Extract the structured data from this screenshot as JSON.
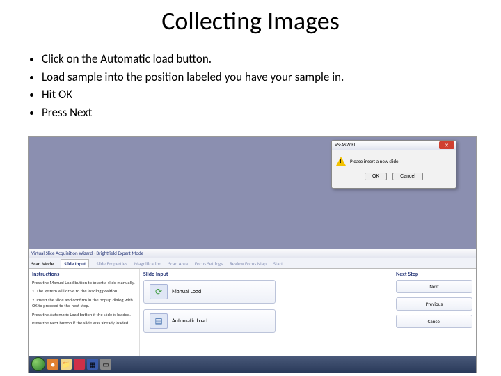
{
  "title": "Collecting Images",
  "bullets": [
    "Click on the Automatic load button.",
    "Load sample into the position labeled you have your sample in.",
    "Hit OK",
    "Press Next"
  ],
  "dialog": {
    "title": "VS-ASW FL",
    "message": "Please insert a new slide.",
    "ok": "OK",
    "cancel": "Cancel"
  },
  "wizard": {
    "window_title": "Virtual Slice Acquisition Wizard - Brightfield Expert Mode",
    "tabs": [
      "Scan Mode",
      "Slide Input",
      "Slide Properties",
      "Magnification",
      "Scan Area",
      "Focus Settings",
      "Review Focus Map",
      "Start"
    ],
    "cols": {
      "instructions_head": "Instructions",
      "instructions": [
        "Press the Manual Load button to insert a slide manually.",
        "1. The system will drive to the loading position.",
        "2. Insert the slide and confirm in the popup dialog with OK to proceed to the next step.",
        "Press the Automatic Load button if the slide is loaded.",
        "Press the Next button if the slide was already loaded."
      ],
      "slide_input_head": "Slide Input",
      "manual_btn": "Manual Load",
      "auto_btn": "Automatic Load",
      "next_head": "Next Step",
      "next_btn": "Next",
      "prev_btn": "Previous",
      "cancel_btn": "Cancel"
    }
  }
}
